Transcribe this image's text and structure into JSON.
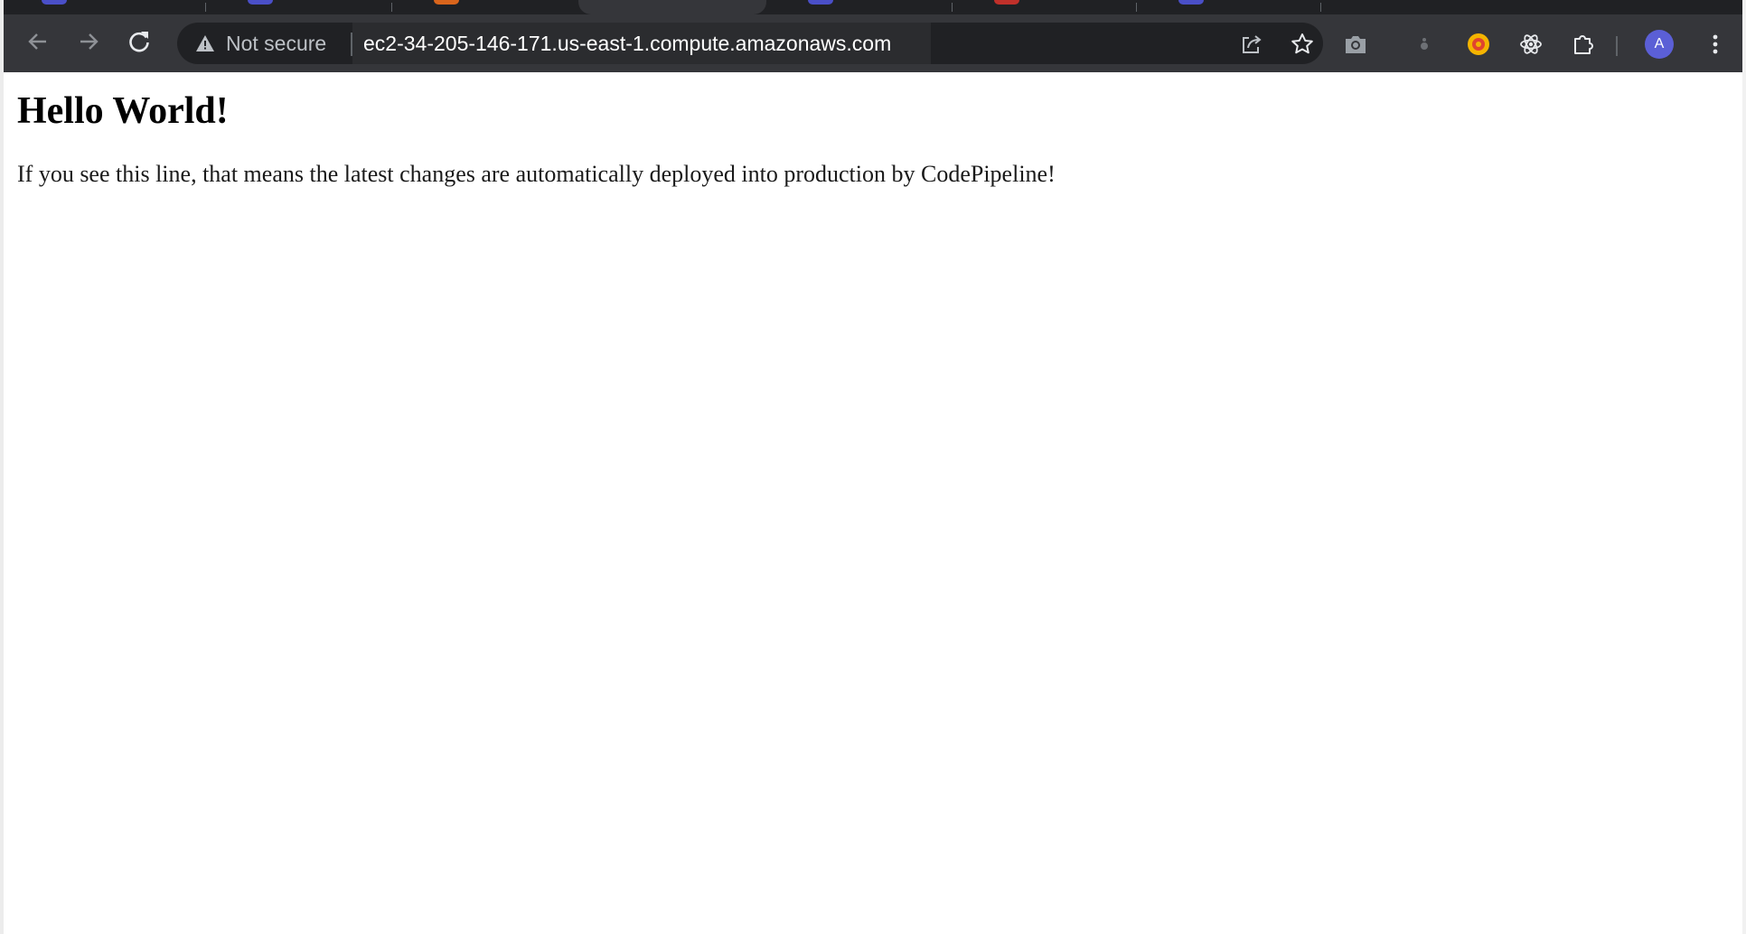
{
  "browser": {
    "security_label": "Not secure",
    "url": "ec2-34-205-146-171.us-east-1.compute.amazonaws.com",
    "profile_initial": "A",
    "icons": {
      "back": "arrow-left-icon",
      "forward": "arrow-right-icon",
      "reload": "reload-icon",
      "warning": "warning-triangle-icon",
      "share": "share-icon",
      "bookmark": "star-icon",
      "screenshot": "camera-icon",
      "extension_a": "extension-dot-icon",
      "extension_b": "colorful-extension-icon",
      "extension_c": "react-atom-icon",
      "extensions": "puzzle-icon",
      "menu": "kebab-menu-icon"
    },
    "colors": {
      "toolbar": "#35363a",
      "tabstrip": "#202124",
      "omnibox": "#202124",
      "avatar": "#5b5fd6"
    }
  },
  "page": {
    "heading": "Hello World!",
    "paragraph": "If you see this line, that means the latest changes are automatically deployed into production by CodePipeline!"
  }
}
